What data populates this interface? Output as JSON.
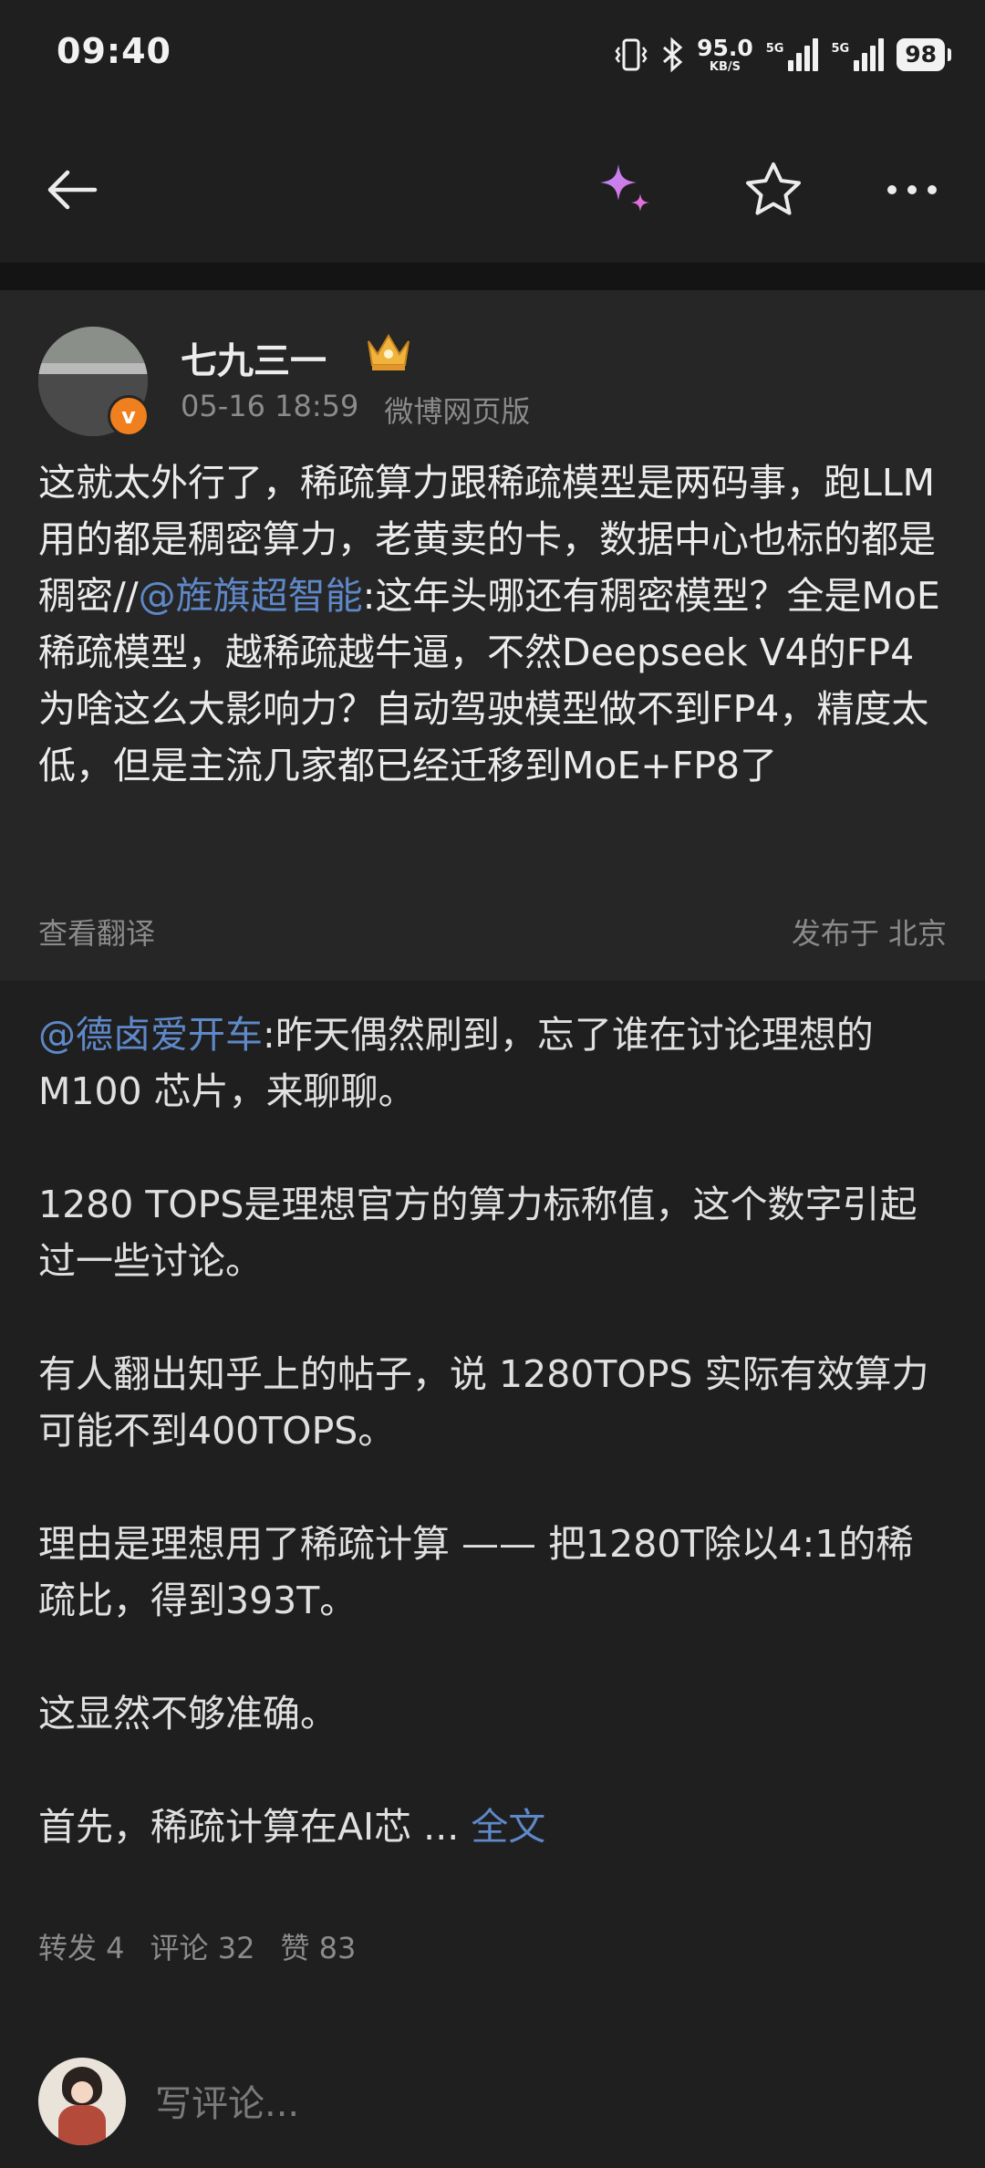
{
  "status_bar": {
    "time": "09:40",
    "net_speed": "95.0",
    "net_unit": "KB/S",
    "sim1": "5G",
    "sim2": "5G",
    "battery": "98"
  },
  "nav": {
    "icons": [
      "back-arrow-icon",
      "ai-sparkle-icon",
      "star-icon",
      "more-icon"
    ]
  },
  "post": {
    "author": "七九三一",
    "timestamp": "05-16 18:59",
    "source": "微博网页版",
    "text_before_mention": "这就太外行了，稀疏算力跟稀疏模型是两码事，跑LLM用的都是稠密算力，老黄卖的卡，数据中心也标的都是稠密//",
    "mention": "@旌旗超智能",
    "text_after_mention": ":这年头哪还有稠密模型？全是MoE稀疏模型，越稀疏越牛逼，不然Deepseek V4的FP4为啥这么大影响力？自动驾驶模型做不到FP4，精度太低，但是主流几家都已经迁移到MoE+FP8了",
    "translate_label": "查看翻译",
    "publish_location": "发布于 北京"
  },
  "original": {
    "mention": "@德卤爱开车",
    "p1": ":昨天偶然刷到，忘了谁在讨论理想的 M100 芯片，来聊聊。",
    "p2": "1280 TOPS是理想官方的算力标称值，这个数字引起过一些讨论。",
    "p3": "有人翻出知乎上的帖子，说 1280TOPS 实际有效算力可能不到400TOPS。",
    "p4": "理由是理想用了稀疏计算 —— 把1280T除以4:1的稀疏比，得到393T。",
    "p5": "这显然不够准确。",
    "p6": "首先，稀疏计算在AI芯  ... ",
    "fulltext_label": "全文",
    "repost_label": "转发 4",
    "comment_label": "评论 32",
    "like_label": "赞 83"
  },
  "comment_bar": {
    "placeholder": "写评论..."
  },
  "colors": {
    "background": "#1f1f1f",
    "card": "#262626",
    "link": "#5e88c8",
    "vip_badge": "#f0801e"
  }
}
